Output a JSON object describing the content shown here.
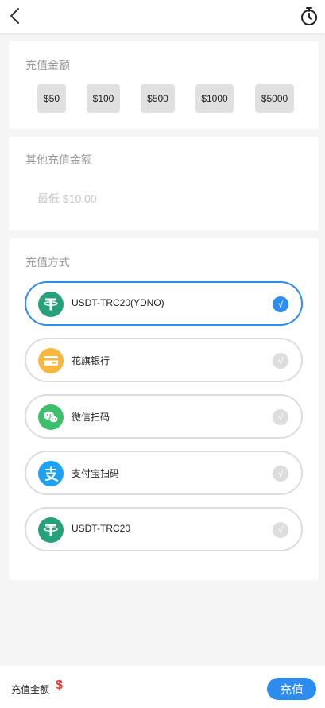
{
  "header": {
    "back_icon": "chevron-left-icon",
    "history_icon": "timer-history-icon"
  },
  "amount_section": {
    "title": "充值金额",
    "options": [
      "$50",
      "$100",
      "$500",
      "$1000",
      "$5000"
    ]
  },
  "other_amount": {
    "title": "其他充值金额",
    "placeholder": "最低 $10.00",
    "value": ""
  },
  "payment_methods": {
    "title": "充值方式",
    "check_mark": "√",
    "items": [
      {
        "label": "USDT-TRC20(YDNO)",
        "icon": "tether-icon",
        "selected": true
      },
      {
        "label": "花旗银行",
        "icon": "bank-card-icon",
        "selected": false
      },
      {
        "label": "微信扫码",
        "icon": "wechat-icon",
        "selected": false
      },
      {
        "label": "支付宝扫码",
        "icon": "alipay-icon",
        "selected": false
      },
      {
        "label": "USDT-TRC20",
        "icon": "tether-icon",
        "selected": false
      }
    ]
  },
  "footer": {
    "total_label": "充值金额",
    "currency_symbol": "$",
    "submit_label": "充值"
  },
  "colors": {
    "accent": "#2d8cf0",
    "tether": "#26a17b",
    "bank": "#f9b73e",
    "wechat": "#3dbf6c",
    "alipay": "#1da1f2",
    "price": "#e53935"
  }
}
